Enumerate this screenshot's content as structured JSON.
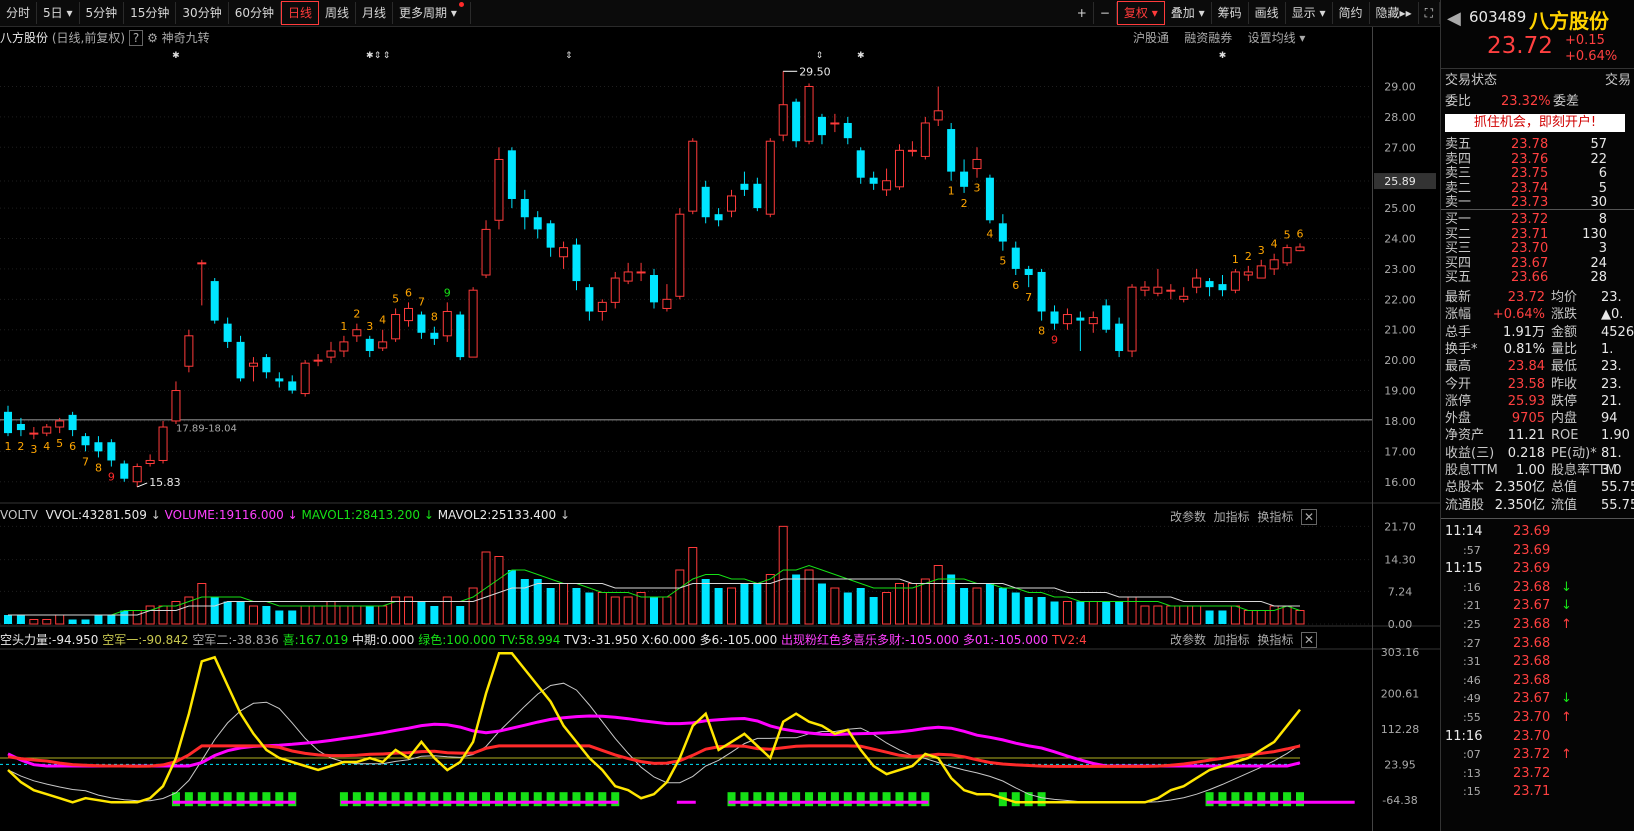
{
  "toolbar": {
    "items": [
      "分时",
      "5日",
      "5分钟",
      "15分钟",
      "30分钟",
      "60分钟",
      "日线",
      "周线",
      "月线",
      "更多周期"
    ],
    "right_items": [
      "+",
      "−",
      "复权",
      "叠加",
      "筹码",
      "画线",
      "显示",
      "简约",
      "隐藏"
    ],
    "active": "日线"
  },
  "stock": {
    "code": "603489",
    "name": "八方股份",
    "price": "23.72",
    "change": "+0.15",
    "change_pct": "+0.64%"
  },
  "chart_header": {
    "name": "八方股份",
    "mode": "(日线,前复权)",
    "indicator": "神奇九转",
    "links": [
      "沪股通",
      "融资融券",
      "设置均线"
    ]
  },
  "price_axis": [
    "29.00",
    "28.00",
    "27.00",
    "25.89",
    "25.00",
    "24.00",
    "23.00",
    "22.00",
    "21.00",
    "20.00",
    "19.00",
    "18.00",
    "17.00",
    "16.00"
  ],
  "annotations": {
    "high": "29.50",
    "low": "15.83",
    "range": "17.89-18.04"
  },
  "volume_header": {
    "name": "VOLTV",
    "vvol": "VVOL:43281.509",
    "volume": "VOLUME:19116.000",
    "mavol1": "MAVOL1:28413.200",
    "mavol2": "MAVOL2:25133.400",
    "links": [
      "改参数",
      "加指标",
      "换指标"
    ]
  },
  "volume_axis": [
    "21.70",
    "14.30",
    "7.24",
    "0.00"
  ],
  "ind_header": {
    "items": [
      {
        "t": "空头力量:-94.950",
        "c": "#e8e8e8"
      },
      {
        "t": "空军一:-90.842",
        "c": "#c8c850"
      },
      {
        "t": "空军二:-38.836",
        "c": "#a8a8a8"
      },
      {
        "t": "喜:167.019",
        "c": "#16e016"
      },
      {
        "t": "中期:0.000",
        "c": "#e8e8e8"
      },
      {
        "t": "绿色:100.000",
        "c": "#16e016"
      },
      {
        "t": "TV:58.994",
        "c": "#16e016"
      },
      {
        "t": "TV3:-31.950",
        "c": "#e8e8e8"
      },
      {
        "t": "X:60.000",
        "c": "#e8e8e8"
      },
      {
        "t": "多6:-105.000",
        "c": "#e8e8e8"
      },
      {
        "t": "出现粉红色多喜乐多财:-105.000",
        "c": "#ff40ff"
      },
      {
        "t": "多01:-105.000",
        "c": "#ff40ff"
      },
      {
        "t": "TV2:4",
        "c": "#ff4040"
      }
    ],
    "links": [
      "改参数",
      "加指标",
      "换指标"
    ]
  },
  "ind_axis": [
    "303.16",
    "200.61",
    "112.28",
    "23.95",
    "-64.38"
  ],
  "quote": {
    "trade_status_label": "交易状态",
    "trade_status_value": "交易",
    "wb_label": "委比",
    "wb_value": "23.32%",
    "wc_label": "委差",
    "banner": "抓住机会，即刻开户!",
    "asks": [
      {
        "label": "卖五",
        "price": "23.78",
        "vol": "57"
      },
      {
        "label": "卖四",
        "price": "23.76",
        "vol": "22"
      },
      {
        "label": "卖三",
        "price": "23.75",
        "vol": "6"
      },
      {
        "label": "卖二",
        "price": "23.74",
        "vol": "5"
      },
      {
        "label": "卖一",
        "price": "23.73",
        "vol": "30"
      }
    ],
    "bids": [
      {
        "label": "买一",
        "price": "23.72",
        "vol": "8"
      },
      {
        "label": "买二",
        "price": "23.71",
        "vol": "130"
      },
      {
        "label": "买三",
        "price": "23.70",
        "vol": "3"
      },
      {
        "label": "买四",
        "price": "23.67",
        "vol": "24"
      },
      {
        "label": "买五",
        "price": "23.66",
        "vol": "28"
      }
    ],
    "stats": [
      {
        "l1": "最新",
        "v1": "23.72",
        "c1": "red",
        "l2": "均价",
        "v2": "23."
      },
      {
        "l1": "涨幅",
        "v1": "+0.64%",
        "c1": "red",
        "l2": "涨跌",
        "v2": "▲0."
      },
      {
        "l1": "总手",
        "v1": "1.91万",
        "c1": "white",
        "l2": "金额",
        "v2": "4526"
      },
      {
        "l1": "换手*",
        "v1": "0.81%",
        "c1": "white",
        "l2": "量比",
        "v2": "1."
      },
      {
        "l1": "最高",
        "v1": "23.84",
        "c1": "red",
        "l2": "最低",
        "v2": "23."
      },
      {
        "l1": "今开",
        "v1": "23.58",
        "c1": "red",
        "l2": "昨收",
        "v2": "23."
      },
      {
        "l1": "涨停",
        "v1": "25.93",
        "c1": "red",
        "l2": "跌停",
        "v2": "21."
      },
      {
        "l1": "外盘",
        "v1": "9705",
        "c1": "red",
        "l2": "内盘",
        "v2": "94"
      },
      {
        "l1": "净资产",
        "v1": "11.21",
        "c1": "white",
        "l2": "ROE",
        "v2": "1.90"
      },
      {
        "l1": "收益(三)",
        "v1": "0.218",
        "c1": "white",
        "l2": "PE(动)*",
        "v2": "81."
      },
      {
        "l1": "股息TTM",
        "v1": "1.00",
        "c1": "white",
        "l2": "股息率TTM",
        "v2": "3.0"
      },
      {
        "l1": "总股本",
        "v1": "2.350亿",
        "c1": "white",
        "l2": "总值",
        "v2": "55.75"
      },
      {
        "l1": "流通股",
        "v1": "2.350亿",
        "c1": "white",
        "l2": "流值",
        "v2": "55.75"
      }
    ],
    "ticks": [
      {
        "t": "11:14",
        "p": "23.69",
        "c": "red",
        "a": ""
      },
      {
        "t": ":57",
        "p": "23.69",
        "c": "red",
        "a": ""
      },
      {
        "t": "11:15",
        "p": "23.69",
        "c": "red",
        "a": ""
      },
      {
        "t": ":16",
        "p": "23.68",
        "c": "red",
        "a": "down"
      },
      {
        "t": ":21",
        "p": "23.67",
        "c": "red",
        "a": "down"
      },
      {
        "t": ":25",
        "p": "23.68",
        "c": "red",
        "a": "up"
      },
      {
        "t": ":27",
        "p": "23.68",
        "c": "red",
        "a": ""
      },
      {
        "t": ":31",
        "p": "23.68",
        "c": "red",
        "a": ""
      },
      {
        "t": ":46",
        "p": "23.68",
        "c": "red",
        "a": ""
      },
      {
        "t": ":49",
        "p": "23.67",
        "c": "red",
        "a": "down"
      },
      {
        "t": ":55",
        "p": "23.70",
        "c": "red",
        "a": "up"
      },
      {
        "t": "11:16",
        "p": "23.70",
        "c": "red",
        "a": ""
      },
      {
        "t": ":07",
        "p": "23.72",
        "c": "red",
        "a": "up"
      },
      {
        "t": ":13",
        "p": "23.72",
        "c": "red",
        "a": ""
      },
      {
        "t": ":15",
        "p": "23.71",
        "c": "red",
        "a": ""
      }
    ]
  },
  "candles": [
    [
      18.3,
      17.6,
      18.5,
      17.5
    ],
    [
      17.9,
      17.7,
      18.1,
      17.5
    ],
    [
      17.6,
      17.6,
      17.8,
      17.4
    ],
    [
      17.6,
      17.8,
      17.9,
      17.5
    ],
    [
      17.8,
      18.0,
      18.1,
      17.6
    ],
    [
      18.2,
      17.7,
      18.3,
      17.5
    ],
    [
      17.5,
      17.2,
      17.6,
      17.0
    ],
    [
      17.3,
      17.0,
      17.5,
      16.8
    ],
    [
      17.3,
      16.7,
      17.4,
      16.5
    ],
    [
      16.6,
      16.1,
      16.7,
      16.0
    ],
    [
      16.0,
      16.5,
      16.6,
      15.83
    ],
    [
      16.6,
      16.7,
      16.9,
      16.5
    ],
    [
      16.7,
      17.8,
      18.0,
      16.6
    ],
    [
      18.0,
      19.0,
      19.3,
      17.9
    ],
    [
      19.8,
      20.8,
      21.0,
      19.6
    ],
    [
      23.2,
      23.2,
      23.3,
      21.8
    ],
    [
      22.6,
      21.3,
      22.7,
      21.2
    ],
    [
      21.2,
      20.6,
      21.4,
      20.4
    ],
    [
      20.6,
      19.4,
      20.8,
      19.3
    ],
    [
      19.8,
      19.9,
      20.1,
      19.3
    ],
    [
      20.1,
      19.6,
      20.2,
      19.4
    ],
    [
      19.4,
      19.3,
      19.6,
      19.1
    ],
    [
      19.3,
      19.0,
      19.5,
      18.9
    ],
    [
      18.9,
      19.9,
      20.0,
      18.8
    ],
    [
      20.0,
      20.0,
      20.2,
      19.8
    ],
    [
      20.1,
      20.3,
      20.6,
      19.9
    ],
    [
      20.3,
      20.6,
      20.8,
      20.1
    ],
    [
      20.8,
      21.0,
      21.2,
      20.6
    ],
    [
      20.7,
      20.3,
      20.8,
      20.1
    ],
    [
      20.4,
      20.6,
      21.0,
      20.3
    ],
    [
      20.7,
      21.5,
      21.7,
      20.6
    ],
    [
      21.3,
      21.7,
      21.9,
      21.1
    ],
    [
      21.5,
      20.9,
      21.6,
      20.7
    ],
    [
      20.9,
      20.7,
      21.1,
      20.5
    ],
    [
      20.8,
      21.6,
      21.9,
      20.6
    ],
    [
      21.5,
      20.1,
      21.6,
      20.0
    ],
    [
      20.1,
      22.3,
      22.4,
      20.1
    ],
    [
      22.8,
      24.3,
      24.6,
      22.7
    ],
    [
      24.6,
      26.6,
      27.0,
      24.3
    ],
    [
      26.9,
      25.3,
      27.0,
      25.0
    ],
    [
      25.3,
      24.7,
      25.6,
      24.3
    ],
    [
      24.7,
      24.3,
      24.9,
      24.0
    ],
    [
      24.5,
      23.7,
      24.6,
      23.4
    ],
    [
      23.4,
      23.7,
      23.9,
      23.0
    ],
    [
      23.8,
      22.6,
      24.0,
      22.3
    ],
    [
      22.4,
      21.6,
      22.5,
      21.3
    ],
    [
      21.6,
      21.9,
      22.0,
      21.3
    ],
    [
      21.9,
      22.7,
      22.9,
      21.7
    ],
    [
      22.6,
      22.9,
      23.2,
      22.5
    ],
    [
      22.9,
      22.9,
      23.2,
      22.6
    ],
    [
      22.8,
      21.9,
      23.0,
      21.7
    ],
    [
      21.7,
      22.0,
      22.5,
      21.6
    ],
    [
      22.1,
      24.8,
      25.0,
      22.0
    ],
    [
      24.9,
      27.2,
      27.3,
      24.8
    ],
    [
      25.7,
      24.7,
      25.9,
      24.5
    ],
    [
      24.8,
      24.6,
      25.0,
      24.4
    ],
    [
      24.9,
      25.4,
      25.6,
      24.7
    ],
    [
      25.8,
      25.6,
      26.2,
      25.4
    ],
    [
      25.8,
      25.0,
      26.0,
      24.9
    ],
    [
      24.8,
      27.2,
      27.3,
      24.7
    ],
    [
      27.4,
      28.4,
      29.5,
      27.2
    ],
    [
      28.5,
      27.2,
      28.6,
      27.0
    ],
    [
      27.2,
      29.0,
      29.1,
      27.1
    ],
    [
      28.0,
      27.4,
      28.1,
      27.1
    ],
    [
      27.8,
      27.8,
      28.1,
      27.5
    ],
    [
      27.8,
      27.3,
      28.0,
      27.1
    ],
    [
      26.9,
      26.0,
      27.0,
      25.8
    ],
    [
      26.0,
      25.8,
      26.2,
      25.6
    ],
    [
      25.6,
      25.9,
      26.3,
      25.4
    ],
    [
      25.7,
      26.9,
      27.1,
      25.6
    ],
    [
      26.9,
      26.9,
      27.2,
      26.7
    ],
    [
      26.7,
      27.8,
      28.0,
      26.6
    ],
    [
      27.9,
      28.2,
      29.0,
      27.7
    ],
    [
      27.6,
      26.2,
      27.8,
      25.9
    ],
    [
      26.2,
      25.7,
      26.6,
      25.5
    ],
    [
      26.3,
      26.6,
      27.0,
      26.0
    ],
    [
      26.0,
      24.6,
      26.1,
      24.5
    ],
    [
      24.5,
      23.9,
      24.8,
      23.6
    ],
    [
      23.7,
      23.0,
      23.9,
      22.8
    ],
    [
      23.0,
      22.8,
      23.1,
      22.4
    ],
    [
      22.9,
      21.6,
      23.0,
      21.3
    ],
    [
      21.6,
      21.2,
      21.8,
      21.0
    ],
    [
      21.2,
      21.5,
      21.7,
      21.0
    ],
    [
      21.4,
      21.3,
      21.6,
      20.3
    ],
    [
      21.2,
      21.4,
      21.6,
      20.9
    ],
    [
      21.8,
      21.0,
      22.0,
      20.9
    ],
    [
      21.2,
      20.3,
      21.4,
      20.1
    ],
    [
      20.3,
      22.4,
      22.5,
      20.1
    ],
    [
      22.3,
      22.4,
      22.6,
      22.1
    ],
    [
      22.2,
      22.4,
      23.0,
      22.1
    ],
    [
      22.3,
      22.3,
      22.5,
      22.0
    ],
    [
      22.0,
      22.1,
      22.4,
      21.9
    ],
    [
      22.4,
      22.7,
      23.0,
      22.2
    ],
    [
      22.6,
      22.4,
      22.7,
      22.1
    ],
    [
      22.5,
      22.3,
      22.8,
      22.1
    ],
    [
      22.3,
      22.9,
      23.0,
      22.2
    ],
    [
      22.8,
      22.9,
      23.1,
      22.6
    ],
    [
      22.7,
      23.1,
      23.3,
      22.7
    ],
    [
      23.0,
      23.3,
      23.5,
      22.8
    ],
    [
      23.2,
      23.7,
      23.8,
      23.1
    ],
    [
      23.6,
      23.72,
      23.84,
      23.58
    ]
  ],
  "tj_labels": [
    {
      "i": 0,
      "t": "1",
      "c": "#ffa500"
    },
    {
      "i": 1,
      "t": "2",
      "c": "#ffa500"
    },
    {
      "i": 2,
      "t": "3",
      "c": "#ffa500"
    },
    {
      "i": 3,
      "t": "4",
      "c": "#ffa500"
    },
    {
      "i": 4,
      "t": "5",
      "c": "#ffa500"
    },
    {
      "i": 5,
      "t": "6",
      "c": "#ffa500"
    },
    {
      "i": 6,
      "t": "7",
      "c": "#ffa500"
    },
    {
      "i": 7,
      "t": "8",
      "c": "#ffa500"
    },
    {
      "i": 8,
      "t": "9",
      "c": "#ff2a2a"
    },
    {
      "i": 26,
      "t": "1",
      "c": "#ffa500"
    },
    {
      "i": 27,
      "t": "2",
      "c": "#ffa500"
    },
    {
      "i": 28,
      "t": "3",
      "c": "#ffa500"
    },
    {
      "i": 29,
      "t": "4",
      "c": "#ffa500"
    },
    {
      "i": 30,
      "t": "5",
      "c": "#ffa500"
    },
    {
      "i": 31,
      "t": "6",
      "c": "#ffa500"
    },
    {
      "i": 32,
      "t": "7",
      "c": "#ffa500"
    },
    {
      "i": 33,
      "t": "8",
      "c": "#ffa500"
    },
    {
      "i": 34,
      "t": "9",
      "c": "#16e016"
    },
    {
      "i": 73,
      "t": "1",
      "c": "#ffa500"
    },
    {
      "i": 74,
      "t": "2",
      "c": "#ffa500"
    },
    {
      "i": 75,
      "t": "3",
      "c": "#ffa500"
    },
    {
      "i": 76,
      "t": "4",
      "c": "#ffa500"
    },
    {
      "i": 77,
      "t": "5",
      "c": "#ffa500"
    },
    {
      "i": 78,
      "t": "6",
      "c": "#ffa500"
    },
    {
      "i": 79,
      "t": "7",
      "c": "#ffa500"
    },
    {
      "i": 80,
      "t": "8",
      "c": "#ffa500"
    },
    {
      "i": 81,
      "t": "9",
      "c": "#ff2a2a"
    },
    {
      "i": 95,
      "t": "1",
      "c": "#ffa500"
    },
    {
      "i": 96,
      "t": "2",
      "c": "#ffa500"
    },
    {
      "i": 97,
      "t": "3",
      "c": "#ffa500"
    },
    {
      "i": 98,
      "t": "4",
      "c": "#ffa500"
    },
    {
      "i": 99,
      "t": "5",
      "c": "#ffa500"
    },
    {
      "i": 100,
      "t": "6",
      "c": "#ffa500"
    }
  ],
  "volumes": [
    2,
    2,
    1,
    1,
    2,
    1,
    1,
    2,
    2,
    3,
    3,
    4,
    4,
    5,
    6,
    9,
    6,
    5,
    5,
    4,
    4,
    3,
    3,
    4,
    4,
    5,
    4,
    4,
    4,
    4,
    6,
    6,
    5,
    4,
    6,
    4,
    8,
    16,
    15,
    12,
    10,
    10,
    8,
    9,
    8,
    7,
    7,
    6,
    6,
    7,
    6,
    6,
    12,
    17,
    10,
    8,
    8,
    9,
    9,
    11,
    21.7,
    11,
    12,
    9,
    8,
    7,
    8,
    6,
    7,
    9,
    9,
    10,
    13,
    11,
    8,
    8,
    9,
    8,
    7,
    6,
    6,
    5,
    5,
    5,
    5,
    5,
    5,
    6,
    4,
    4,
    4,
    4,
    4,
    3,
    3,
    4,
    3,
    3,
    4,
    4,
    3
  ],
  "mavol1": [
    2,
    2,
    2,
    2,
    2,
    2,
    2,
    2,
    2,
    3,
    3,
    3,
    4,
    4,
    5,
    6,
    6,
    6,
    6,
    5,
    5,
    4,
    4,
    4,
    4,
    4,
    4,
    4,
    4,
    4,
    5,
    5,
    5,
    5,
    5,
    5,
    6,
    8,
    10,
    12,
    12,
    11,
    10,
    9,
    9,
    8,
    7,
    7,
    7,
    6,
    6,
    6,
    8,
    10,
    11,
    11,
    10,
    10,
    9,
    10,
    12,
    12,
    13,
    12,
    11,
    10,
    9,
    8,
    8,
    8,
    8,
    9,
    10,
    10,
    10,
    9,
    9,
    8,
    8,
    7,
    7,
    6,
    6,
    5,
    5,
    5,
    5,
    5,
    5,
    5,
    4,
    4,
    4,
    4,
    4,
    4,
    3,
    3,
    3,
    4,
    3
  ],
  "mavol2": [
    2,
    2,
    2,
    2,
    2,
    2,
    2,
    2,
    2,
    2,
    2,
    3,
    3,
    3,
    4,
    4,
    4,
    5,
    5,
    5,
    5,
    5,
    5,
    5,
    5,
    5,
    5,
    5,
    5,
    5,
    5,
    5,
    5,
    5,
    5,
    5,
    5,
    6,
    7,
    8,
    8,
    9,
    9,
    9,
    9,
    9,
    9,
    8,
    8,
    8,
    8,
    8,
    8,
    9,
    9,
    9,
    9,
    9,
    9,
    9,
    10,
    10,
    10,
    10,
    10,
    10,
    10,
    10,
    10,
    10,
    9,
    9,
    9,
    9,
    9,
    9,
    9,
    9,
    8,
    8,
    8,
    8,
    7,
    7,
    7,
    7,
    6,
    6,
    6,
    6,
    6,
    5,
    5,
    5,
    5,
    5,
    5,
    5,
    4,
    4,
    4
  ],
  "ind_yellow": [
    10,
    -20,
    -40,
    -50,
    -60,
    -70,
    -60,
    -65,
    -70,
    -70,
    -70,
    -60,
    -30,
    40,
    150,
    280,
    290,
    220,
    150,
    100,
    60,
    40,
    30,
    20,
    10,
    20,
    30,
    30,
    40,
    30,
    60,
    40,
    80,
    40,
    10,
    30,
    80,
    200,
    300,
    300,
    260,
    220,
    180,
    120,
    80,
    40,
    10,
    -30,
    -40,
    -60,
    -50,
    -20,
    40,
    120,
    150,
    60,
    80,
    100,
    70,
    40,
    130,
    150,
    130,
    120,
    100,
    110,
    60,
    20,
    0,
    10,
    20,
    50,
    40,
    -10,
    -40,
    -50,
    -50,
    -60,
    -70,
    -70,
    -70,
    -70,
    -70,
    -70,
    -70,
    -70,
    -70,
    -70,
    -70,
    -60,
    -40,
    -30,
    -10,
    10,
    20,
    30,
    40,
    60,
    80,
    120,
    160
  ]
}
